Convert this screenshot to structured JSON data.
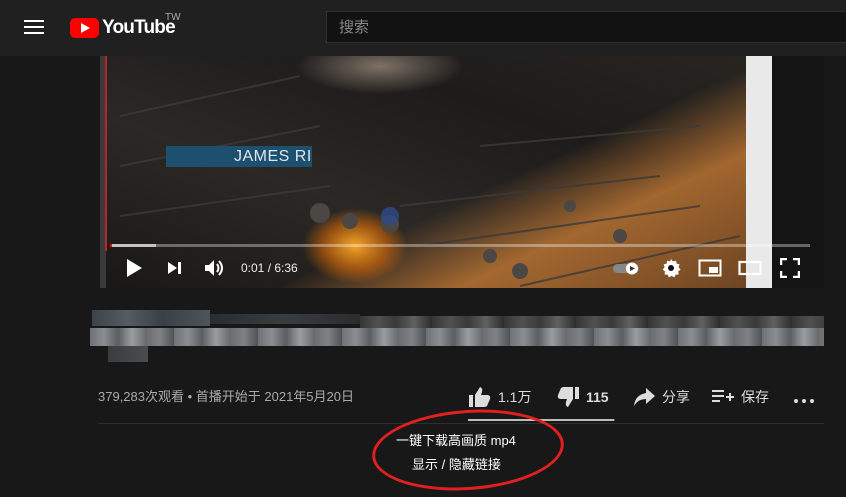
{
  "header": {
    "logo_text": "YouTube",
    "region": "TW",
    "search_placeholder": "搜索"
  },
  "video": {
    "overlay_text": "JAMES RI",
    "time_current": "0:01",
    "time_total": "6:36",
    "time_display": "0:01 / 6:36",
    "progress_fraction": 0.003,
    "icons": [
      "play-icon",
      "next-icon",
      "volume-icon",
      "autoplay-toggle-icon",
      "settings-icon",
      "miniplayer-icon",
      "theater-icon",
      "fullscreen-icon"
    ]
  },
  "meta": {
    "views_text": "379,283次观看 • 首播开始于 2021年5月20日",
    "like_count": "1.1万",
    "dislike_count": "115",
    "share_label": "分享",
    "save_label": "保存",
    "like_ratio": 0.99
  },
  "extension": {
    "download_label": "一键下载高画质 mp4",
    "toggle_label": "显示 / 隐藏链接"
  },
  "colors": {
    "brand_red": "#ff0000",
    "annotation_red": "#e02020",
    "background": "#181818"
  }
}
